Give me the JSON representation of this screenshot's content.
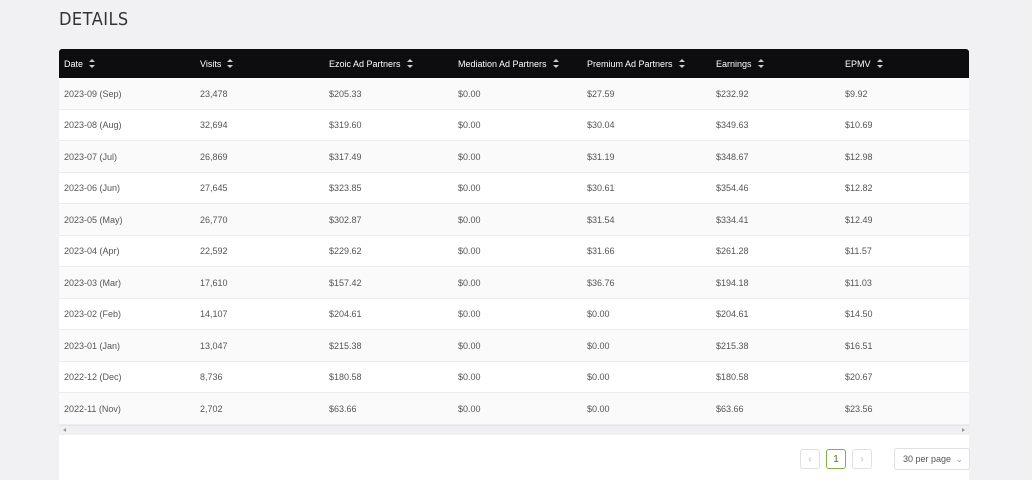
{
  "section": {
    "title": "DETAILS"
  },
  "table": {
    "columns": [
      {
        "label": "Date"
      },
      {
        "label": "Visits"
      },
      {
        "label": "Ezoic Ad Partners"
      },
      {
        "label": "Mediation Ad Partners"
      },
      {
        "label": "Premium Ad Partners"
      },
      {
        "label": "Earnings"
      },
      {
        "label": "EPMV"
      }
    ],
    "rows": [
      [
        "2023-09 (Sep)",
        "23,478",
        "$205.33",
        "$0.00",
        "$27.59",
        "$232.92",
        "$9.92"
      ],
      [
        "2023-08 (Aug)",
        "32,694",
        "$319.60",
        "$0.00",
        "$30.04",
        "$349.63",
        "$10.69"
      ],
      [
        "2023-07 (Jul)",
        "26,869",
        "$317.49",
        "$0.00",
        "$31.19",
        "$348.67",
        "$12.98"
      ],
      [
        "2023-06 (Jun)",
        "27,645",
        "$323.85",
        "$0.00",
        "$30.61",
        "$354.46",
        "$12.82"
      ],
      [
        "2023-05 (May)",
        "26,770",
        "$302.87",
        "$0.00",
        "$31.54",
        "$334.41",
        "$12.49"
      ],
      [
        "2023-04 (Apr)",
        "22,592",
        "$229.62",
        "$0.00",
        "$31.66",
        "$261.28",
        "$11.57"
      ],
      [
        "2023-03 (Mar)",
        "17,610",
        "$157.42",
        "$0.00",
        "$36.76",
        "$194.18",
        "$11.03"
      ],
      [
        "2023-02 (Feb)",
        "14,107",
        "$204.61",
        "$0.00",
        "$0.00",
        "$204.61",
        "$14.50"
      ],
      [
        "2023-01 (Jan)",
        "13,047",
        "$215.38",
        "$0.00",
        "$0.00",
        "$215.38",
        "$16.51"
      ],
      [
        "2022-12 (Dec)",
        "8,736",
        "$180.58",
        "$0.00",
        "$0.00",
        "$180.58",
        "$20.67"
      ],
      [
        "2022-11 (Nov)",
        "2,702",
        "$63.66",
        "$0.00",
        "$0.00",
        "$63.66",
        "$23.56"
      ]
    ]
  },
  "pagination": {
    "prev": "‹",
    "current": "1",
    "next": "›",
    "per_page": "30 per page",
    "per_page_chevron": "⌄"
  }
}
